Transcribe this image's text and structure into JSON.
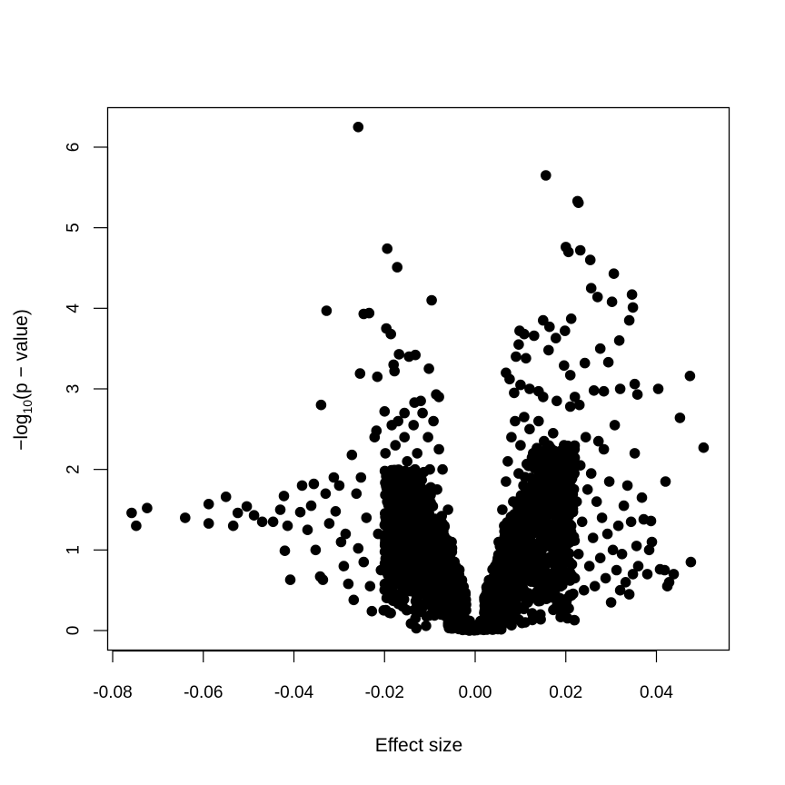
{
  "chart_data": {
    "type": "scatter",
    "title": "",
    "xlabel": "Effect size",
    "ylabel_parts": {
      "prefix": "−log",
      "subscript": "10",
      "suffix": "(p − value)"
    },
    "ylabel": "-log10(p - value)",
    "xlim": [
      -0.08,
      0.055
    ],
    "ylim": [
      0,
      6.4
    ],
    "x_ticks": [
      -0.08,
      -0.06,
      -0.04,
      -0.02,
      0.0,
      0.02,
      0.04
    ],
    "x_tick_labels": [
      "-0.08",
      "-0.06",
      "-0.04",
      "-0.02",
      "0.00",
      "0.02",
      "0.04"
    ],
    "y_ticks": [
      0,
      1,
      2,
      3,
      4,
      5,
      6
    ],
    "y_tick_labels": [
      "0",
      "1",
      "2",
      "3",
      "4",
      "5",
      "6"
    ],
    "grid": false,
    "legend": "none",
    "point_color": "#000000",
    "points": [
      [
        -0.0258,
        6.25
      ],
      [
        0.0156,
        5.65
      ],
      [
        0.0226,
        5.33
      ],
      [
        0.0228,
        5.31
      ],
      [
        -0.0194,
        4.74
      ],
      [
        -0.0172,
        4.51
      ],
      [
        0.02,
        4.76
      ],
      [
        0.0206,
        4.7
      ],
      [
        0.0232,
        4.72
      ],
      [
        0.0254,
        4.6
      ],
      [
        0.0306,
        4.43
      ],
      [
        -0.0096,
        4.1
      ],
      [
        -0.0328,
        3.97
      ],
      [
        -0.0246,
        3.93
      ],
      [
        -0.0234,
        3.94
      ],
      [
        -0.0196,
        3.75
      ],
      [
        -0.0186,
        3.68
      ],
      [
        0.0256,
        4.25
      ],
      [
        0.027,
        4.14
      ],
      [
        0.0302,
        4.08
      ],
      [
        0.0346,
        4.17
      ],
      [
        0.0348,
        4.01
      ],
      [
        0.034,
        3.85
      ],
      [
        0.0318,
        3.6
      ],
      [
        0.0276,
        3.5
      ],
      [
        -0.0168,
        3.43
      ],
      [
        -0.0146,
        3.4
      ],
      [
        -0.0132,
        3.42
      ],
      [
        -0.018,
        3.3
      ],
      [
        -0.0178,
        3.22
      ],
      [
        -0.0102,
        3.25
      ],
      [
        -0.0254,
        3.19
      ],
      [
        -0.0216,
        3.15
      ],
      [
        -0.034,
        2.8
      ],
      [
        -0.012,
        2.85
      ],
      [
        -0.0134,
        2.83
      ],
      [
        -0.0086,
        2.93
      ],
      [
        -0.008,
        2.9
      ],
      [
        -0.0156,
        2.7
      ],
      [
        -0.02,
        2.72
      ],
      [
        0.0098,
        3.72
      ],
      [
        0.0108,
        3.68
      ],
      [
        0.015,
        3.85
      ],
      [
        0.0164,
        3.77
      ],
      [
        0.0212,
        3.87
      ],
      [
        0.0198,
        3.72
      ],
      [
        0.0178,
        3.63
      ],
      [
        0.013,
        3.66
      ],
      [
        0.0096,
        3.55
      ],
      [
        0.009,
        3.4
      ],
      [
        0.0112,
        3.38
      ],
      [
        0.0162,
        3.48
      ],
      [
        0.0196,
        3.29
      ],
      [
        0.021,
        3.17
      ],
      [
        0.0242,
        3.32
      ],
      [
        0.0294,
        3.33
      ],
      [
        0.0076,
        3.12
      ],
      [
        0.0068,
        3.2
      ],
      [
        0.0284,
        2.97
      ],
      [
        0.0262,
        2.98
      ],
      [
        0.032,
        3.0
      ],
      [
        0.0352,
        3.06
      ],
      [
        0.0358,
        2.93
      ],
      [
        0.0404,
        3.0
      ],
      [
        0.0474,
        3.16
      ],
      [
        0.012,
        3.0
      ],
      [
        0.014,
        2.97
      ],
      [
        0.015,
        2.9
      ],
      [
        0.018,
        2.85
      ],
      [
        0.022,
        2.9
      ],
      [
        0.021,
        2.78
      ],
      [
        0.023,
        2.8
      ],
      [
        0.0086,
        2.95
      ],
      [
        0.01,
        3.05
      ],
      [
        -0.055,
        1.66
      ],
      [
        -0.0588,
        1.57
      ],
      [
        -0.0504,
        1.54
      ],
      [
        -0.0524,
        1.46
      ],
      [
        -0.0534,
        1.3
      ],
      [
        -0.0488,
        1.43
      ],
      [
        -0.047,
        1.35
      ],
      [
        -0.0446,
        1.35
      ],
      [
        -0.0758,
        1.46
      ],
      [
        -0.0724,
        1.52
      ],
      [
        -0.0748,
        1.3
      ],
      [
        -0.064,
        1.4
      ],
      [
        -0.0588,
        1.33
      ],
      [
        -0.0422,
        1.67
      ],
      [
        -0.043,
        1.5
      ],
      [
        -0.0414,
        1.3
      ],
      [
        -0.042,
        0.99
      ],
      [
        -0.0408,
        0.63
      ],
      [
        -0.0386,
        1.47
      ],
      [
        -0.0382,
        1.8
      ],
      [
        -0.037,
        1.25
      ],
      [
        -0.0362,
        1.55
      ],
      [
        -0.0356,
        1.82
      ],
      [
        -0.0352,
        1.0
      ],
      [
        -0.0342,
        0.67
      ],
      [
        -0.0336,
        0.63
      ],
      [
        -0.033,
        1.7
      ],
      [
        -0.0322,
        1.33
      ],
      [
        -0.0312,
        1.9
      ],
      [
        -0.0308,
        1.48
      ],
      [
        -0.03,
        1.8
      ],
      [
        -0.0296,
        1.1
      ],
      [
        -0.029,
        0.8
      ],
      [
        -0.0286,
        1.2
      ],
      [
        -0.028,
        0.58
      ],
      [
        -0.0272,
        2.18
      ],
      [
        -0.0268,
        0.38
      ],
      [
        -0.0262,
        1.7
      ],
      [
        -0.0258,
        1.02
      ],
      [
        -0.0252,
        1.9
      ],
      [
        -0.0246,
        0.85
      ],
      [
        -0.024,
        1.4
      ],
      [
        -0.0232,
        0.55
      ],
      [
        -0.0228,
        0.24
      ],
      [
        -0.0222,
        2.4
      ],
      [
        -0.0218,
        2.48
      ],
      [
        -0.0214,
        1.2
      ],
      [
        -0.0208,
        0.75
      ],
      [
        -0.0202,
        0.25
      ],
      [
        -0.0198,
        2.2
      ],
      [
        -0.0194,
        1.6
      ],
      [
        -0.019,
        0.95
      ],
      [
        -0.0184,
        2.55
      ],
      [
        -0.0176,
        2.3
      ],
      [
        -0.0172,
        0.45
      ],
      [
        -0.017,
        2.6
      ],
      [
        -0.0164,
        1.75
      ],
      [
        -0.016,
        0.3
      ],
      [
        -0.0156,
        2.4
      ],
      [
        -0.015,
        2.1
      ],
      [
        -0.0146,
        1.3
      ],
      [
        -0.0142,
        0.6
      ],
      [
        -0.0136,
        2.55
      ],
      [
        -0.0132,
        0.15
      ],
      [
        -0.0128,
        2.2
      ],
      [
        -0.0124,
        1.85
      ],
      [
        -0.012,
        0.85
      ],
      [
        -0.0116,
        2.7
      ],
      [
        -0.0112,
        1.45
      ],
      [
        -0.0108,
        0.35
      ],
      [
        -0.0104,
        2.4
      ],
      [
        -0.01,
        2.0
      ],
      [
        -0.0096,
        1.1
      ],
      [
        -0.0092,
        2.6
      ],
      [
        -0.0088,
        0.65
      ],
      [
        -0.0084,
        1.75
      ],
      [
        -0.008,
        2.25
      ],
      [
        -0.0076,
        0.2
      ],
      [
        -0.0072,
        2.0
      ],
      [
        -0.0068,
        1.3
      ],
      [
        -0.0064,
        0.9
      ],
      [
        -0.006,
        1.5
      ],
      [
        -0.0056,
        0.5
      ],
      [
        -0.0052,
        1.1
      ],
      [
        -0.0048,
        0.8
      ],
      [
        -0.0044,
        0.3
      ],
      [
        -0.004,
        0.65
      ],
      [
        -0.0036,
        0.45
      ],
      [
        -0.0032,
        0.2
      ],
      [
        -0.0028,
        0.35
      ],
      [
        -0.0024,
        0.15
      ],
      [
        -0.002,
        0.25
      ],
      [
        -0.0016,
        0.1
      ],
      [
        -0.0012,
        0.12
      ],
      [
        -0.0008,
        0.05
      ],
      [
        -0.0004,
        0.03
      ],
      [
        0.0,
        0.01
      ],
      [
        0.0004,
        0.04
      ],
      [
        0.0008,
        0.07
      ],
      [
        0.0012,
        0.12
      ],
      [
        0.0016,
        0.1
      ],
      [
        0.002,
        0.22
      ],
      [
        0.0024,
        0.18
      ],
      [
        0.0028,
        0.35
      ],
      [
        0.0032,
        0.3
      ],
      [
        0.0036,
        0.55
      ],
      [
        0.004,
        0.45
      ],
      [
        0.0044,
        0.8
      ],
      [
        0.0048,
        0.7
      ],
      [
        0.0052,
        1.1
      ],
      [
        0.0056,
        0.95
      ],
      [
        0.006,
        1.5
      ],
      [
        0.0064,
        1.3
      ],
      [
        0.0068,
        1.85
      ],
      [
        0.0072,
        2.1
      ],
      [
        0.0076,
        0.5
      ],
      [
        0.008,
        2.4
      ],
      [
        0.0084,
        1.6
      ],
      [
        0.0088,
        2.6
      ],
      [
        0.0092,
        0.25
      ],
      [
        0.0096,
        1.95
      ],
      [
        0.01,
        2.3
      ],
      [
        0.0104,
        0.8
      ],
      [
        0.0108,
        2.65
      ],
      [
        0.0112,
        1.4
      ],
      [
        0.0116,
        0.35
      ],
      [
        0.012,
        2.5
      ],
      [
        0.0124,
        1.1
      ],
      [
        0.0128,
        2.2
      ],
      [
        0.0132,
        0.6
      ],
      [
        0.0136,
        1.8
      ],
      [
        0.014,
        2.6
      ],
      [
        0.0144,
        0.2
      ],
      [
        0.0148,
        1.45
      ],
      [
        0.0152,
        2.35
      ],
      [
        0.0156,
        0.9
      ],
      [
        0.016,
        2.1
      ],
      [
        0.0164,
        0.45
      ],
      [
        0.0168,
        1.7
      ],
      [
        0.0172,
        2.45
      ],
      [
        0.0176,
        1.25
      ],
      [
        0.018,
        0.3
      ],
      [
        0.0184,
        2.0
      ],
      [
        0.0188,
        0.75
      ],
      [
        0.0192,
        1.55
      ],
      [
        0.0196,
        2.3
      ],
      [
        0.02,
        1.05
      ],
      [
        0.0204,
        0.4
      ],
      [
        0.0208,
        1.85
      ],
      [
        0.0212,
        1.3
      ],
      [
        0.0216,
        2.1
      ],
      [
        0.022,
        0.65
      ],
      [
        0.0224,
        1.6
      ],
      [
        0.0228,
        0.95
      ],
      [
        0.0232,
        2.05
      ],
      [
        0.0236,
        1.35
      ],
      [
        0.024,
        0.5
      ],
      [
        0.0244,
        2.4
      ],
      [
        0.0248,
        1.75
      ],
      [
        0.0252,
        0.8
      ],
      [
        0.0256,
        1.95
      ],
      [
        0.026,
        1.15
      ],
      [
        0.0264,
        0.55
      ],
      [
        0.0268,
        1.6
      ],
      [
        0.0272,
        2.35
      ],
      [
        0.0276,
        0.9
      ],
      [
        0.028,
        1.4
      ],
      [
        0.0284,
        2.25
      ],
      [
        0.0288,
        0.65
      ],
      [
        0.0292,
        1.2
      ],
      [
        0.0296,
        1.85
      ],
      [
        0.03,
        0.35
      ],
      [
        0.0304,
        1.0
      ],
      [
        0.0308,
        2.55
      ],
      [
        0.0312,
        0.75
      ],
      [
        0.0316,
        1.3
      ],
      [
        0.032,
        0.5
      ],
      [
        0.0324,
        0.95
      ],
      [
        0.0328,
        1.55
      ],
      [
        0.0332,
        0.6
      ],
      [
        0.0336,
        1.8
      ],
      [
        0.034,
        0.45
      ],
      [
        0.0344,
        1.35
      ],
      [
        0.0348,
        0.7
      ],
      [
        0.0352,
        2.2
      ],
      [
        0.0356,
        1.05
      ],
      [
        0.036,
        0.8
      ],
      [
        0.0368,
        1.65
      ],
      [
        0.0372,
        1.38
      ],
      [
        0.038,
        0.7
      ],
      [
        0.0384,
        1.0
      ],
      [
        0.0388,
        1.36
      ],
      [
        0.039,
        1.1
      ],
      [
        0.0408,
        0.76
      ],
      [
        0.0418,
        0.75
      ],
      [
        0.042,
        1.85
      ],
      [
        0.0424,
        0.55
      ],
      [
        0.0428,
        0.6
      ],
      [
        0.0438,
        0.7
      ],
      [
        0.0452,
        2.64
      ],
      [
        0.0476,
        0.85
      ],
      [
        0.0504,
        2.27
      ]
    ],
    "dense_clusters": [
      {
        "x_range": [
          -0.02,
          -0.002
        ],
        "y_range": [
          0.05,
          2.0
        ],
        "description": "dense negative-effect arm of volcano"
      },
      {
        "x_range": [
          0.002,
          0.022
        ],
        "y_range": [
          0.05,
          2.3
        ],
        "description": "dense positive-effect arm of volcano"
      }
    ]
  }
}
